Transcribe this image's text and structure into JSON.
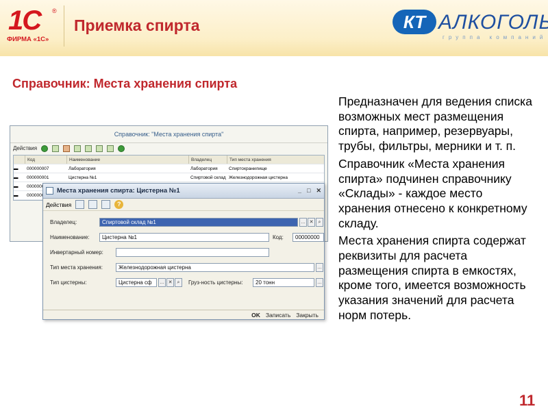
{
  "header": {
    "logo_1c": "1С",
    "logo_firm": "ФИРМА «1С»",
    "title": "Приемка спирта",
    "partner_badge": "КТ",
    "partner_name": "АЛКОГОЛЬ",
    "partner_sub": "группа компаний"
  },
  "subtitle": "Справочник: Места хранения спирта",
  "description": [
    "Предназначен для ведения списка возможных мест размещения спирта, например, резервуары, трубы, фильтры, мерники и т. п.",
    "Справочник «Места хранения спирта» подчинен справочнику «Склады» - каждое место хранения отнесено к конкретному складу.",
    "Места хранения спирта содержат реквизиты для расчета размещения спирта в емкостях, кроме того, имеется возможность указания значений для расчета норм потерь."
  ],
  "page_number": "11",
  "list_window": {
    "title": "Справочник: \"Места хранения спирта\"",
    "actions_label": "Действия",
    "columns": [
      "Код",
      "Наименование",
      "Владелец",
      "Тип места хранения"
    ],
    "rows": [
      {
        "code": "000000007",
        "name": "Лаборатория",
        "owner": "Лаборатория",
        "type": "Спиртохранилище"
      },
      {
        "code": "000000001",
        "name": "Цистерна №1",
        "owner": "Спиртовой склад №1",
        "type": "Железнодорожная цистерна"
      },
      {
        "code": "0000000",
        "name": "",
        "owner": "",
        "type": ""
      },
      {
        "code": "0000000",
        "name": "",
        "owner": "",
        "type": ""
      }
    ]
  },
  "form": {
    "title": "Места хранения спирта: Цистерна №1",
    "actions_label": "Действия",
    "help_label": "?",
    "owner_label": "Владелец:",
    "owner_value": "Спиртовой склад №1",
    "name_label": "Наименование:",
    "name_value": "Цистерна №1",
    "code_label": "Код:",
    "code_value": "00000000",
    "inventory_label": "Инвертарный номер:",
    "inventory_value": "",
    "storage_type_label": "Тип места хранения:",
    "storage_type_value": "Железнодорожная цистерна",
    "tank_type_label": "Тип цистерны:",
    "tank_type_value": "Цистерна сф",
    "capacity_label": "Груз-ность цистерны:",
    "capacity_value": "20 тонн",
    "ok_label": "OK",
    "save_label": "Записать",
    "close_label": "Закрыть"
  },
  "colors": {
    "accent_red": "#c0282d",
    "brand_blue": "#1565b8",
    "selection": "#3d64b0"
  }
}
